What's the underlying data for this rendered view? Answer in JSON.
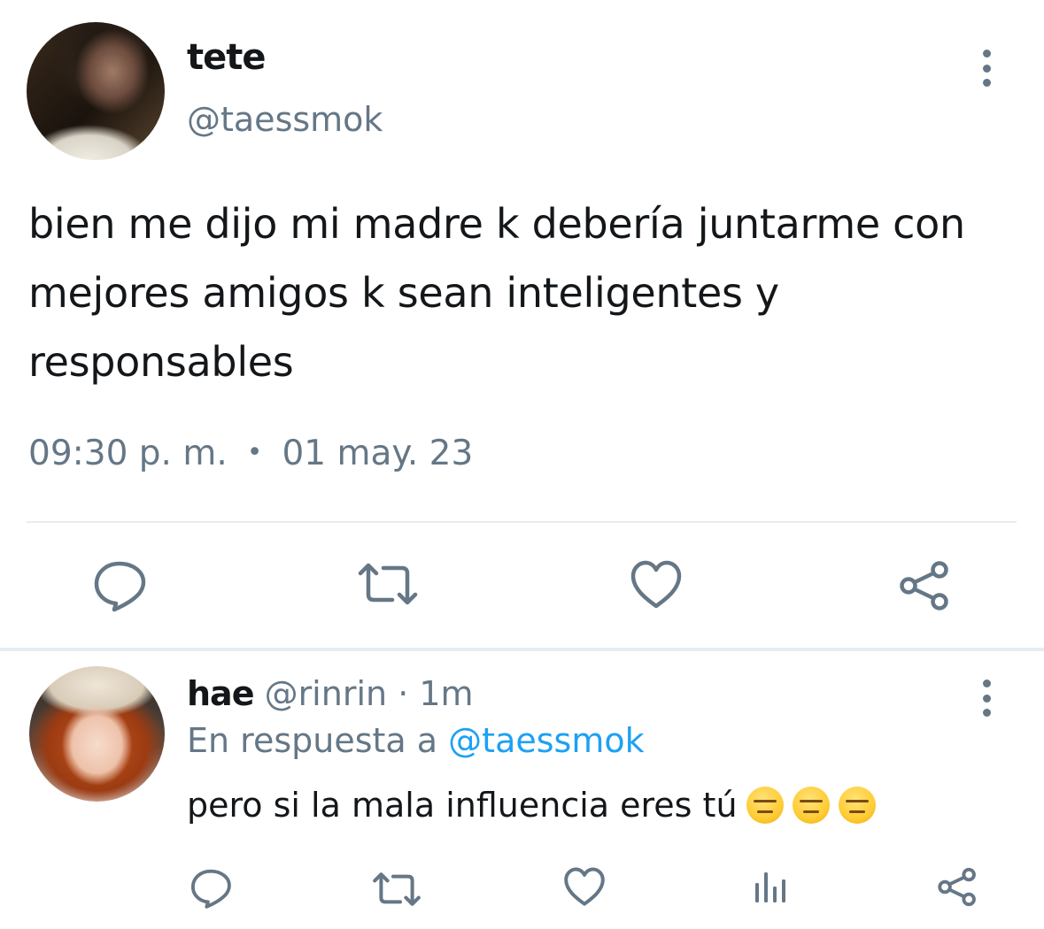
{
  "colors": {
    "text_primary": "#14171a",
    "text_secondary": "#657786",
    "link": "#1da1f2",
    "divider": "#e6ecf0"
  },
  "tweet": {
    "author": {
      "name": "tete",
      "handle": "@taessmok",
      "avatar_icon": "profile-photo"
    },
    "text": "bien me dijo mi madre k debería juntarme con mejores amigos k sean inteligentes y responsables",
    "time": "09:30 p. m.",
    "separator": "•",
    "date": "01 may. 23",
    "actions": [
      "reply-icon",
      "retweet-icon",
      "like-icon",
      "share-icon"
    ]
  },
  "reply": {
    "author": {
      "name": "hae",
      "handle": "@rinrin",
      "separator": "·",
      "time": "1m",
      "avatar_icon": "profile-photo"
    },
    "replying_to_prefix": "En respuesta a",
    "replying_to_handle": "@taessmok",
    "text": "pero si la mala influencia eres tú",
    "emojis": [
      "expressionless-face",
      "expressionless-face",
      "expressionless-face"
    ],
    "actions": [
      "reply-icon",
      "retweet-icon",
      "like-icon",
      "views-icon",
      "share-icon"
    ]
  }
}
